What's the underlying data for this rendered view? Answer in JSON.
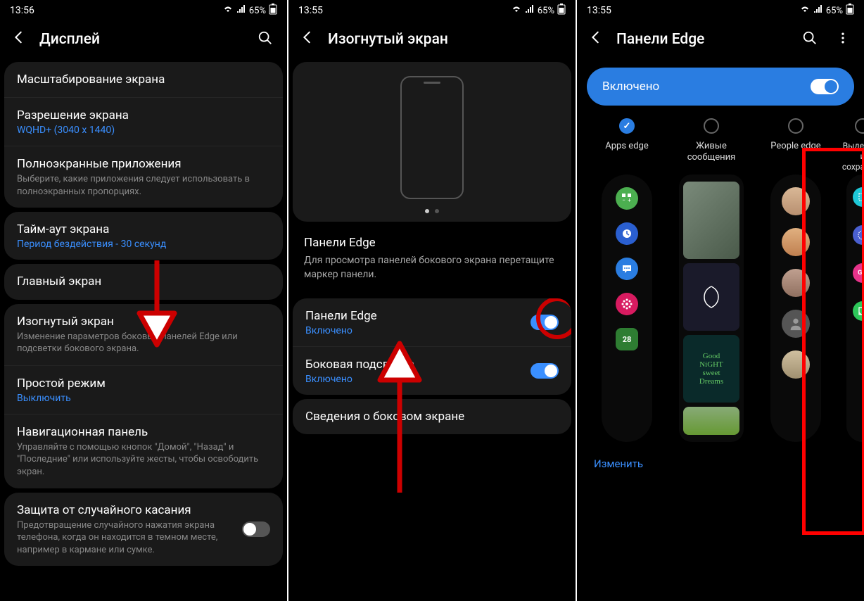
{
  "screen1": {
    "time": "13:56",
    "battery": "65%",
    "title": "Дисплей",
    "items": {
      "scaling": "Масштабирование экрана",
      "resolution_title": "Разрешение экрана",
      "resolution_sub": "WQHD+ (3040 x 1440)",
      "fullscreen_title": "Полноэкранные приложения",
      "fullscreen_sub": "Выберите, какие приложения следует использовать в полноэкранных пропорциях.",
      "timeout_title": "Тайм-аут экрана",
      "timeout_sub": "Период бездействия - 30 секунд",
      "home": "Главный экран",
      "edge_title": "Изогнутый экран",
      "edge_sub": "Изменение параметров боковых панелей Edge или подсветки бокового экрана.",
      "simple_title": "Простой режим",
      "simple_sub": "Выключить",
      "nav_title": "Навигационная панель",
      "nav_sub": "Управляйте с помощью кнопок \"Домой\", \"Назад\" и \"Последние\" или используйте жесты, чтобы освободить экран.",
      "touch_title": "Защита от случайного касания",
      "touch_sub": "Предотвращение случайного нажатия экрана телефона, когда он находится в темном месте, например в кармане или сумке."
    }
  },
  "screen2": {
    "time": "13:55",
    "battery": "65%",
    "title": "Изогнутый экран",
    "desc_title": "Панели Edge",
    "desc_text": "Для просмотра панелей бокового экрана перетащите маркер панели.",
    "panel_edge_title": "Панели Edge",
    "panel_edge_sub": "Включено",
    "side_light_title": "Боковая подсветка",
    "side_light_sub": "Включено",
    "about": "Сведения о боковом экране"
  },
  "screen3": {
    "time": "13:55",
    "battery": "65%",
    "title": "Панели Edge",
    "enabled": "Включено",
    "panels": {
      "apps": "Apps edge",
      "live": "Живые сообщения",
      "people": "People edge",
      "clip": "Выделить и сохранить"
    },
    "edit": "Изменить"
  }
}
